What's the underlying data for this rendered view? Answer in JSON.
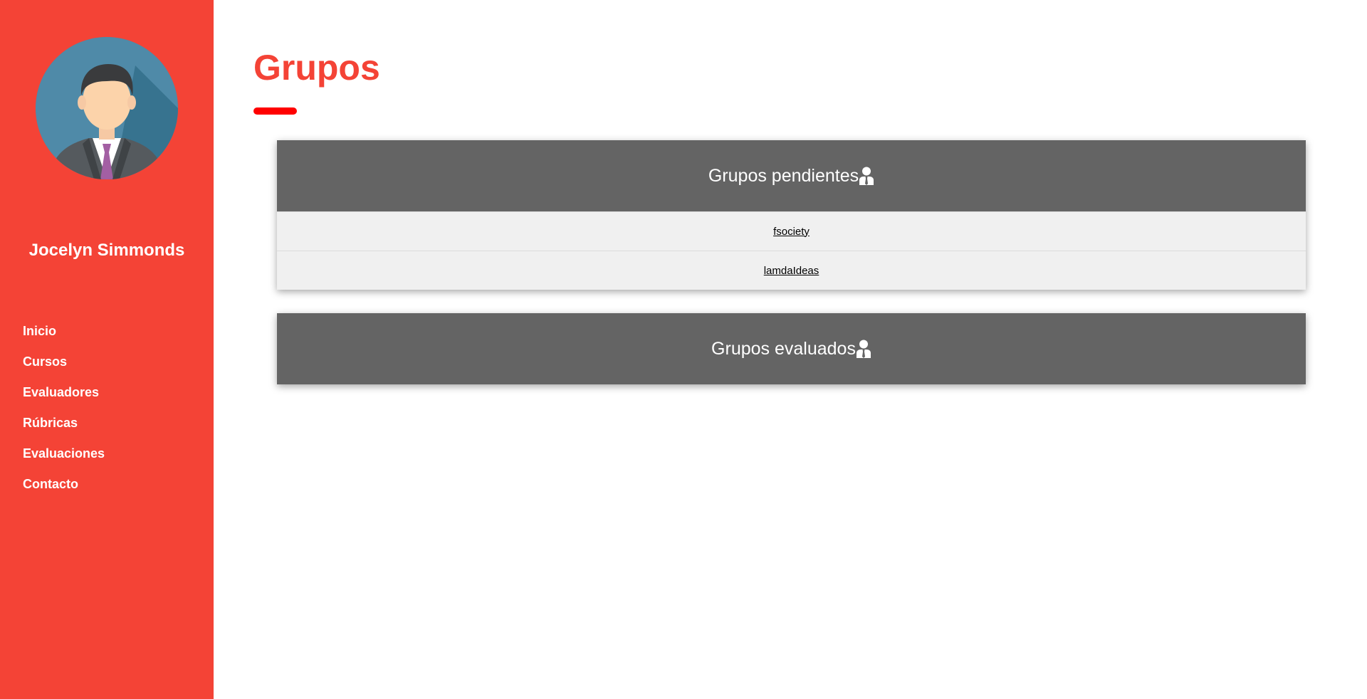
{
  "sidebar": {
    "user_name": "Jocelyn Simmonds",
    "nav": [
      {
        "label": "Inicio"
      },
      {
        "label": "Cursos"
      },
      {
        "label": "Evaluadores"
      },
      {
        "label": "Rúbricas"
      },
      {
        "label": "Evaluaciones"
      },
      {
        "label": "Contacto"
      }
    ]
  },
  "main": {
    "title": "Grupos",
    "pending": {
      "heading": "Grupos pendientes",
      "icon": "person-tie-icon",
      "groups": [
        "fsociety",
        "lamdaIdeas"
      ]
    },
    "evaluated": {
      "heading": "Grupos evaluados",
      "icon": "person-tie-icon",
      "groups": []
    }
  },
  "colors": {
    "accent": "#f44336",
    "underline": "#ff0000",
    "card_header": "#646464",
    "card_body": "#f0f0f0"
  }
}
